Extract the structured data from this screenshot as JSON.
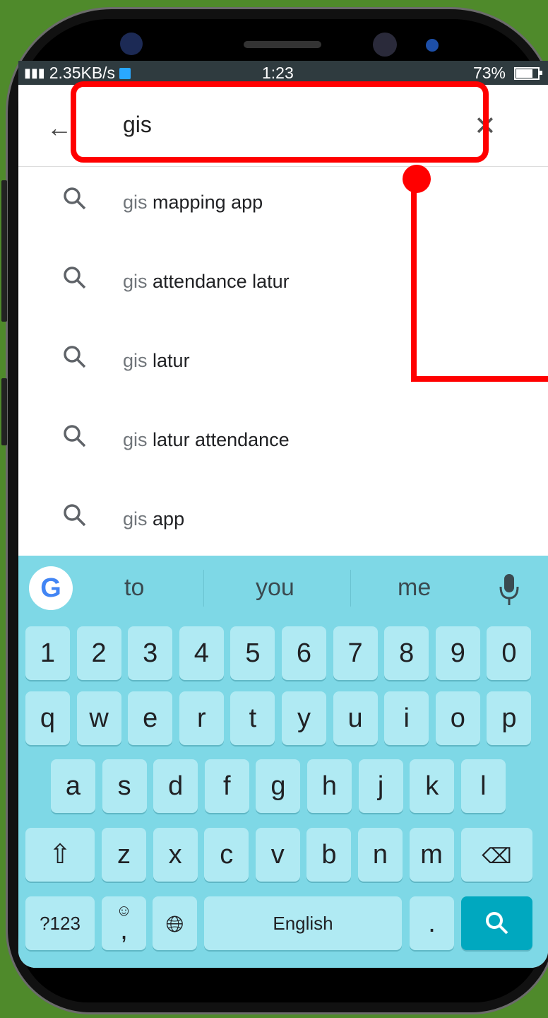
{
  "status_bar": {
    "network": "4G",
    "speed": "2.35KB/s",
    "time": "1:23",
    "battery": "73%",
    "battery_level": 0.73
  },
  "search": {
    "query": "gis",
    "back_icon": "arrow-left-icon",
    "clear_icon": "close-icon"
  },
  "suggestions": [
    {
      "prefix": "gis",
      "rest": "mapping app"
    },
    {
      "prefix": "gis",
      "rest": "attendance latur"
    },
    {
      "prefix": "gis",
      "rest": "latur"
    },
    {
      "prefix": "gis",
      "rest": "latur attendance"
    },
    {
      "prefix": "gis",
      "rest": "app"
    }
  ],
  "keyboard": {
    "word_suggestions": [
      "to",
      "you",
      "me"
    ],
    "row_numbers": [
      "1",
      "2",
      "3",
      "4",
      "5",
      "6",
      "7",
      "8",
      "9",
      "0"
    ],
    "row1": [
      "q",
      "w",
      "e",
      "r",
      "t",
      "y",
      "u",
      "i",
      "o",
      "p"
    ],
    "row2": [
      "a",
      "s",
      "d",
      "f",
      "g",
      "h",
      "j",
      "k",
      "l"
    ],
    "row3": [
      "z",
      "x",
      "c",
      "v",
      "b",
      "n",
      "m"
    ],
    "symbols_label": "?123",
    "comma_label": ",",
    "space_label": "English",
    "period_label": ".",
    "accent_color": "#00a8bf",
    "background_color": "#7ed8e6"
  },
  "annotation": {
    "color": "#ff0000"
  }
}
